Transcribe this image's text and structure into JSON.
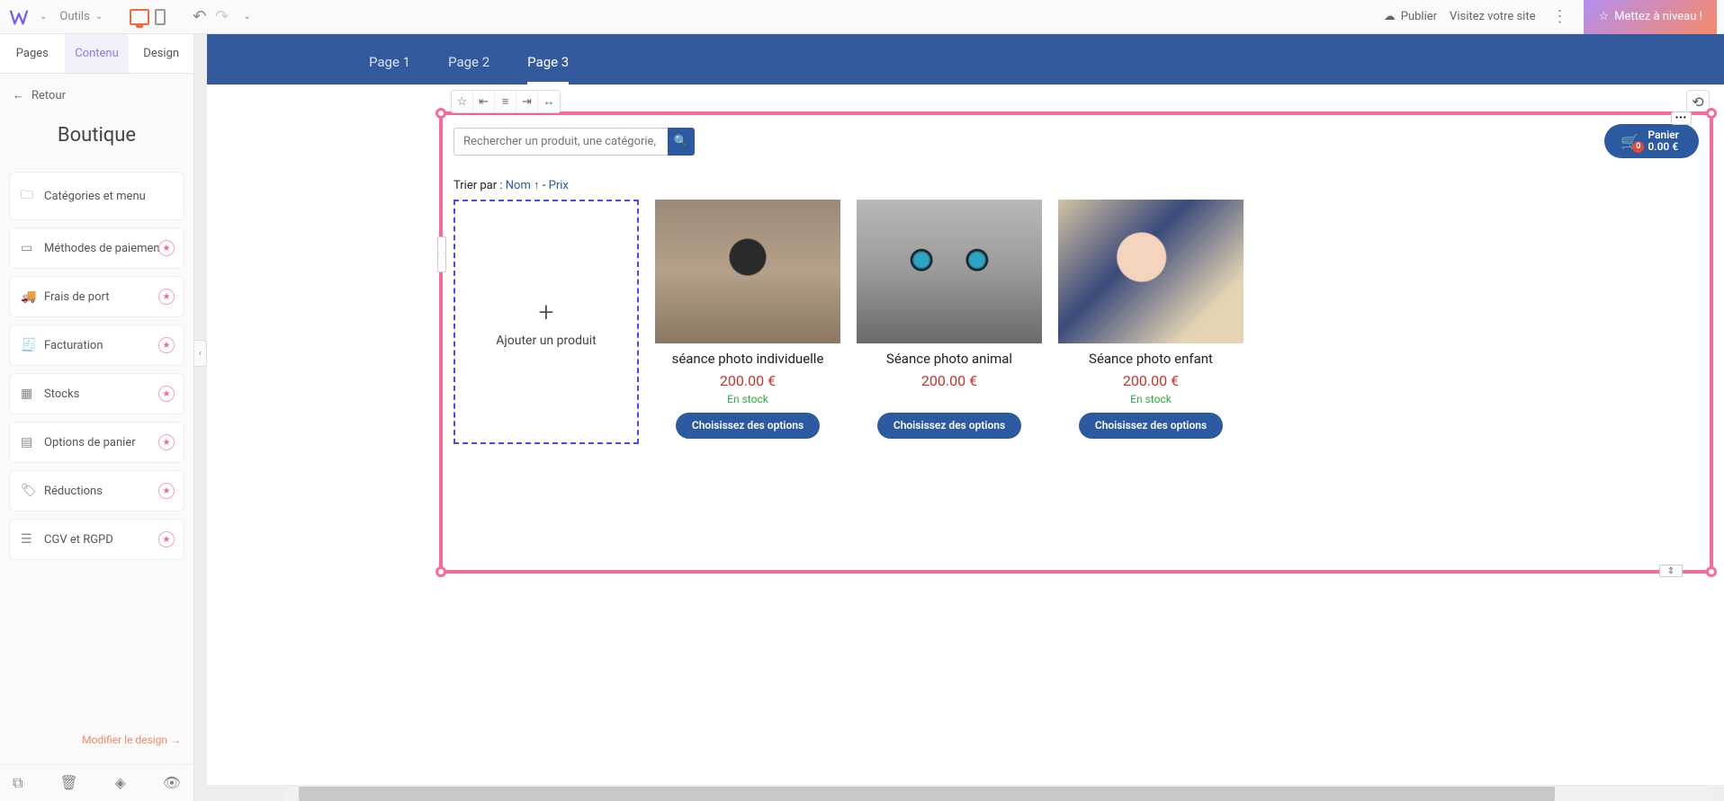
{
  "topbar": {
    "tools_label": "Outils",
    "publish_label": "Publier",
    "visit_label": "Visitez votre site",
    "upgrade_label": "Mettez à niveau !"
  },
  "leftpanel": {
    "tabs": {
      "pages": "Pages",
      "contenu": "Contenu",
      "design": "Design"
    },
    "back": "Retour",
    "title": "Boutique",
    "items": [
      {
        "label": "Catégories et menu",
        "star": false
      },
      {
        "label": "Méthodes de paiement",
        "star": true
      },
      {
        "label": "Frais de port",
        "star": true
      },
      {
        "label": "Facturation",
        "star": true
      },
      {
        "label": "Stocks",
        "star": true
      },
      {
        "label": "Options de panier",
        "star": true
      },
      {
        "label": "Réductions",
        "star": true
      },
      {
        "label": "CGV et RGPD",
        "star": true
      }
    ],
    "modify_design": "Modifier le design →"
  },
  "site": {
    "pages": {
      "p1": "Page 1",
      "p2": "Page 2",
      "p3": "Page 3"
    }
  },
  "shop": {
    "search_placeholder": "Rechercher un produit, une catégorie, ...",
    "cart": {
      "title": "Panier",
      "total": "0.00 €",
      "count": "0"
    },
    "sort": {
      "prefix": "Trier par : ",
      "name": "Nom ↑",
      "sep": " - ",
      "price": "Prix"
    },
    "add_product": "Ajouter un produit",
    "products": [
      {
        "title": "séance photo individuelle",
        "price": "200.00 €",
        "stock": "En stock",
        "cta": "Choisissez des options"
      },
      {
        "title": "Séance photo animal",
        "price": "200.00 €",
        "stock": "",
        "cta": "Choisissez des options"
      },
      {
        "title": "Séance photo enfant",
        "price": "200.00 €",
        "stock": "En stock",
        "cta": "Choisissez des options"
      }
    ]
  }
}
